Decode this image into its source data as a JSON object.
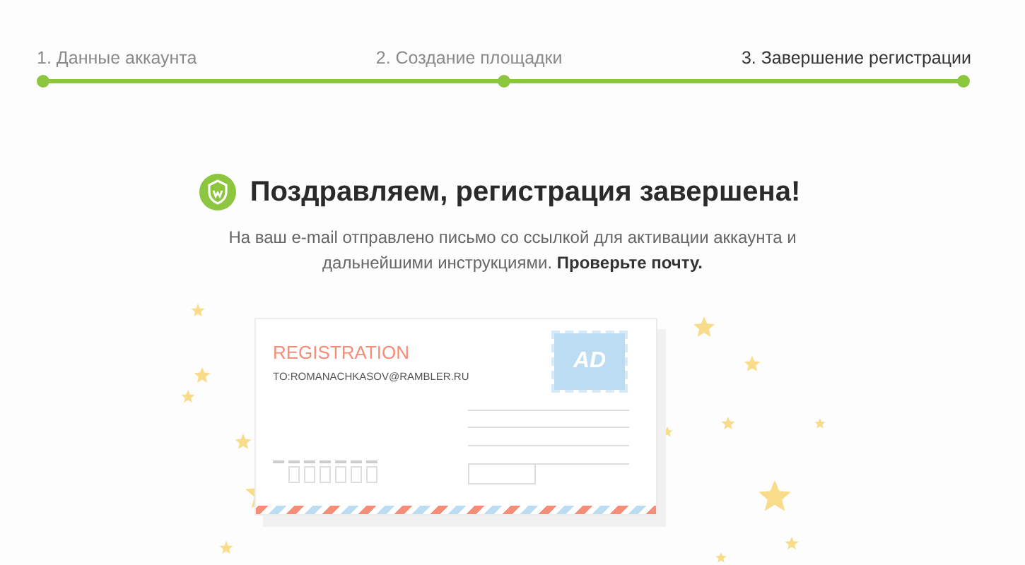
{
  "steps": [
    {
      "label": "1. Данные аккаунта",
      "current": false
    },
    {
      "label": "2. Создание площадки",
      "current": false
    },
    {
      "label": "3. Завершение регистрации",
      "current": true
    }
  ],
  "title": "Поздравляем, регистрация завершена!",
  "message": "На ваш e-mail отправлено письмо со ссылкой для активации аккаунта и дальнейшими инструкциями. **Проверьте почту.**",
  "envelope": {
    "heading": "REGISTRATION",
    "to_label": "TO:",
    "to_address": "ROMANACHKASOV@RAMBLER.RU",
    "stamp": "AD"
  }
}
